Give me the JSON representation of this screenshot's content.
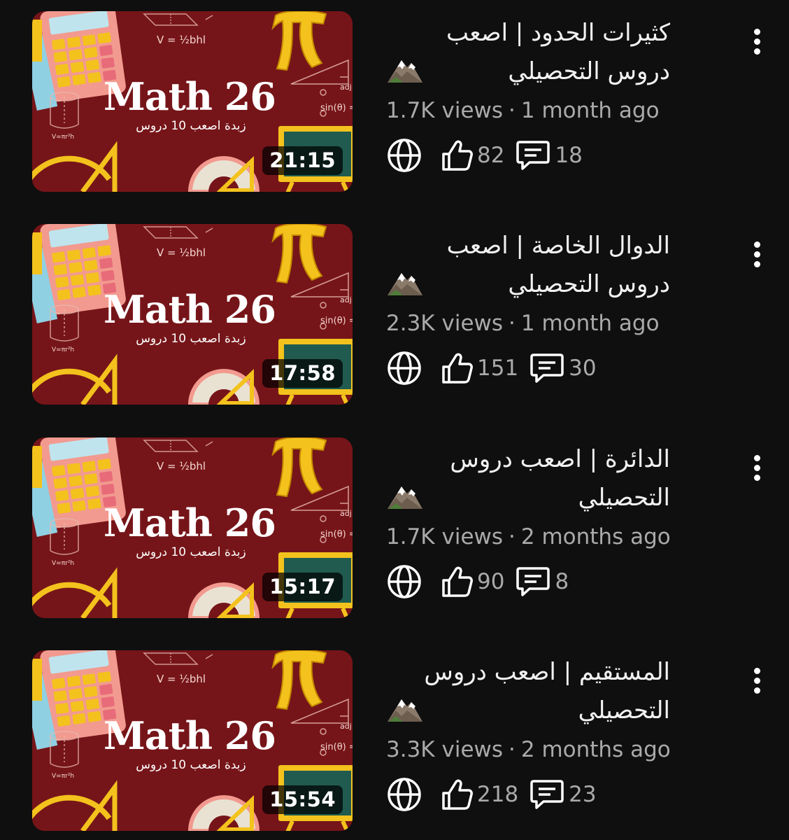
{
  "thumbnail": {
    "title": "Math 26",
    "subtitle": "زبدة اصعب 10 دروس",
    "formula_volume": "V = ½bhl",
    "formula_sin": "sin(θ) =",
    "label_adj": "adj",
    "label_cyl": "V=πr²h",
    "pi_symbol": "π"
  },
  "videos": [
    {
      "title_line1": "كثيرات الحدود | اصعب",
      "title_line2": "دروس التحصيلي",
      "duration": "21:15",
      "views": "1.7K views",
      "age": "1 month ago",
      "likes": "82",
      "comments": "18"
    },
    {
      "title_line1": "الدوال الخاصة | اصعب",
      "title_line2": "دروس التحصيلي",
      "duration": "17:58",
      "views": "2.3K views",
      "age": "1 month ago",
      "likes": "151",
      "comments": "30"
    },
    {
      "title_line1": "الدائرة | اصعب دروس",
      "title_line2": "التحصيلي",
      "duration": "15:17",
      "views": "1.7K views",
      "age": "2 months ago",
      "likes": "90",
      "comments": "8"
    },
    {
      "title_line1": "المستقيم | اصعب دروس",
      "title_line2": "التحصيلي",
      "duration": "15:54",
      "views": "3.3K views",
      "age": "2 months ago",
      "likes": "218",
      "comments": "23"
    }
  ],
  "meta_separator": "·",
  "icons": {
    "visibility": "globe-icon",
    "likes": "thumbs-up-icon",
    "comments": "comment-icon",
    "menu": "more-vertical-icon",
    "emoji": "mountain-emoji"
  },
  "colors": {
    "background": "#0f0f0f",
    "thumbnail_bg": "#761519",
    "text_primary": "#f1f1f1",
    "text_secondary": "#aaaaaa",
    "thumb_yellow": "#f4c21d"
  }
}
